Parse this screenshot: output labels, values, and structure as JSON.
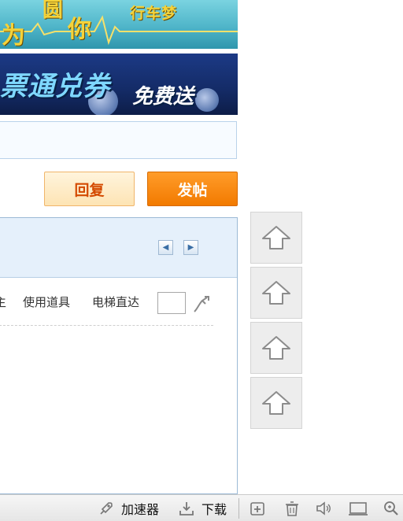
{
  "banner_top": {
    "chars": [
      "为",
      "圆",
      "你"
    ],
    "tagline": "行车梦"
  },
  "banner_mid": {
    "main": "票通兑券",
    "sub": "免费送"
  },
  "actions": {
    "reply_label": "回复",
    "post_label": "发帖"
  },
  "thread_toolbar": {
    "item_author": "主",
    "item_tools": "使用道具",
    "item_elevator": "电梯直达"
  },
  "pager": {
    "prev_icon": "arrow-left-icon",
    "next_icon": "arrow-right-icon"
  },
  "side_buttons": [
    {
      "icon": "arrow-up-icon"
    },
    {
      "icon": "arrow-up-icon"
    },
    {
      "icon": "arrow-up-icon"
    },
    {
      "icon": "arrow-up-icon"
    }
  ],
  "statusbar": {
    "accelerator_label": "加速器",
    "download_label": "下载",
    "icons": [
      "rocket-icon",
      "download-icon",
      "plus-box-icon",
      "trash-icon",
      "speaker-icon",
      "monitor-icon",
      "zoom-icon"
    ]
  },
  "colors": {
    "accent_orange": "#f27a00",
    "reply_text": "#d44a00",
    "panel_border": "#9cbad6",
    "panel_head_bg": "#e5f0fb"
  }
}
